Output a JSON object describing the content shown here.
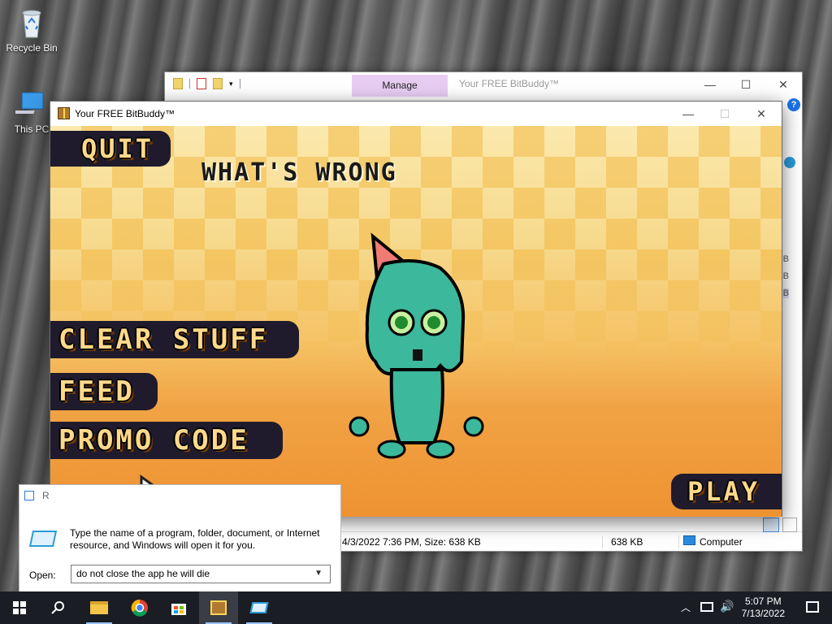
{
  "desktop": {
    "icons": [
      {
        "label": "Recycle Bin",
        "icon": "recycle-bin-icon"
      },
      {
        "label": "This PC",
        "icon": "computer-icon"
      }
    ]
  },
  "explorer": {
    "tab_manage": "Manage",
    "title": "Your FREE BitBuddy™",
    "kb_fragments": [
      "B",
      "B",
      "B"
    ],
    "status": {
      "details": "4/3/2022 7:36 PM, Size: 638 KB",
      "size": "638 KB",
      "location": "Computer"
    }
  },
  "game_window": {
    "title": "Your FREE BitBuddy™",
    "heading": "WHAT'S WRONG",
    "buttons": {
      "quit": "QUIT",
      "clear": "CLEAR STUFF",
      "feed": "FEED",
      "promo": "PROMO CODE",
      "play": "PLAY"
    }
  },
  "run_dialog": {
    "title_fragment": "R",
    "description": "Type the name of a program, folder, document, or Internet resource, and Windows will open it for you.",
    "open_label": "Open:",
    "open_value": "do not close the app he will die"
  },
  "taskbar": {
    "time": "5:07 PM",
    "date": "7/13/2022",
    "items": [
      "start-icon",
      "search-icon",
      "file-explorer-icon",
      "chrome-icon",
      "store-icon",
      "bitbuddy-icon",
      "run-icon"
    ]
  },
  "colors": {
    "accent_manage": "#e8cdf2",
    "buddy_body": "#3cb89c",
    "button_bg": "#1f1b2c",
    "button_text": "#ffd98a"
  }
}
